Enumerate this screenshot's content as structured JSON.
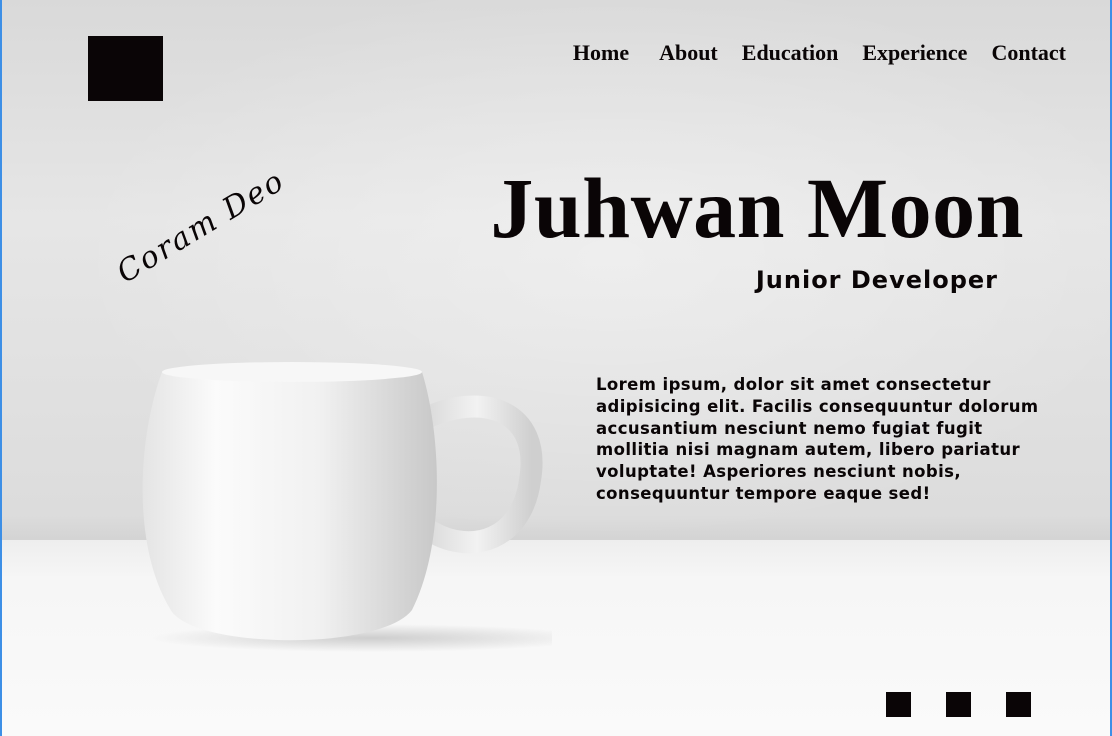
{
  "nav": {
    "items": [
      {
        "label": "Home"
      },
      {
        "label": "About"
      },
      {
        "label": "Education"
      },
      {
        "label": "Experience"
      },
      {
        "label": "Contact"
      }
    ]
  },
  "hero": {
    "name": "Juhwan Moon",
    "role": "Junior Developer",
    "signature": "Coram Deo"
  },
  "intro": {
    "text": "Lorem ipsum, dolor sit amet consectetur adipisicing elit. Facilis consequuntur dolorum accusantium nesciunt nemo fugiat fugit mollitia nisi magnam autem, libero pariatur voluptate! Asperiores nesciunt nobis, consequuntur tempore eaque sed!"
  },
  "colors": {
    "ink": "#0a0506",
    "frame": "#3d8fe6"
  },
  "slider": {
    "dots": 3
  },
  "background_image": "white-mug-on-table"
}
